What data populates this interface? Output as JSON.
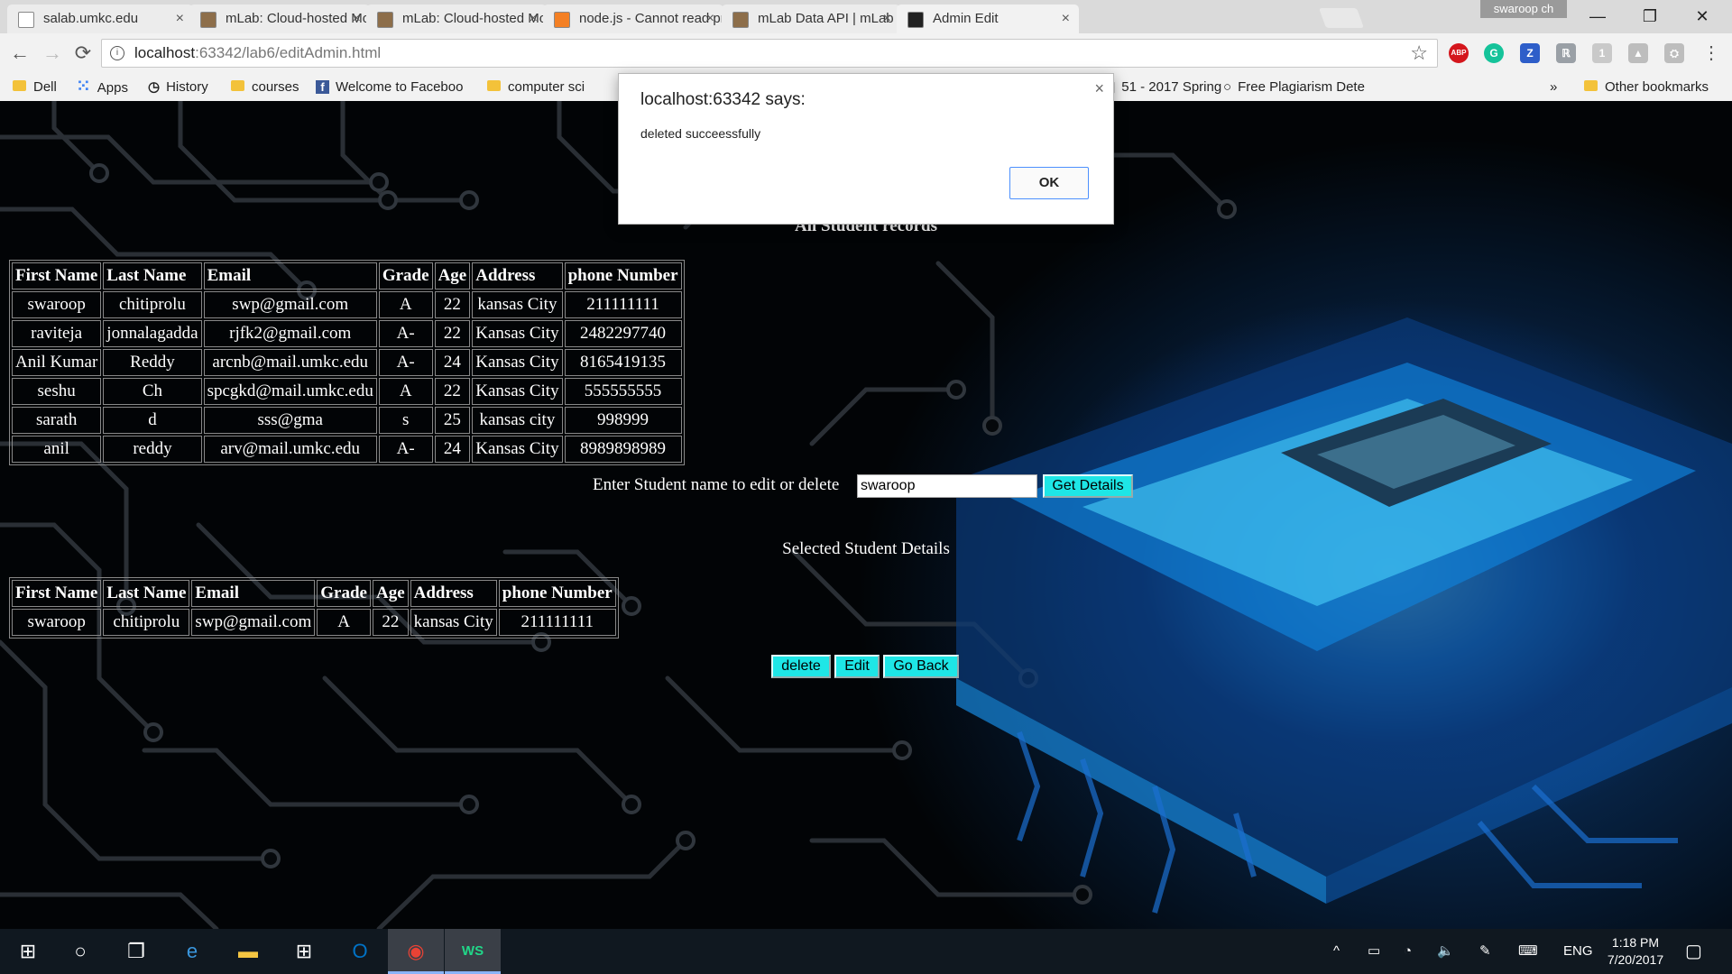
{
  "browser": {
    "tabs": [
      {
        "title": "salab.umkc.edu",
        "favicon_color": "#ffffff"
      },
      {
        "title": "mLab: Cloud-hosted Mo",
        "favicon_color": "#8d6e4a"
      },
      {
        "title": "mLab: Cloud-hosted Mo",
        "favicon_color": "#8d6e4a"
      },
      {
        "title": "node.js - Cannot read pr",
        "favicon_color": "#f48024"
      },
      {
        "title": "mLab Data API | mLab D",
        "favicon_color": "#8d6e4a"
      },
      {
        "title": "Admin Edit",
        "favicon_color": "#222222",
        "active": true
      }
    ],
    "tab_close_symbol": "×",
    "profile_name": "swaroop ch",
    "window_controls": {
      "minimize": "—",
      "restore": "❐",
      "close": "✕"
    },
    "nav": {
      "back": "←",
      "forward": "→",
      "reload": "⟳"
    },
    "address": {
      "host": "localhost",
      "path": ":63342/lab6/editAdmin.html"
    },
    "bookmarks": [
      {
        "label": "Dell",
        "icon": "folder-icon"
      },
      {
        "label": "Apps",
        "icon": "apps-grid-icon"
      },
      {
        "label": "History",
        "icon": "history-icon"
      },
      {
        "label": "courses",
        "icon": "folder-icon"
      },
      {
        "label": "Welcome to Faceboo",
        "icon": "facebook-icon"
      },
      {
        "label": "computer sci",
        "icon": "folder-icon"
      },
      {
        "label": "51 - 2017 Spring",
        "icon": "page-icon"
      },
      {
        "label": "Free Plagiarism Dete",
        "icon": "search-icon"
      }
    ],
    "bookmarks_overflow": "»",
    "other_bookmarks": "Other bookmarks",
    "extensions": [
      {
        "name": "abp",
        "label": "ABP",
        "color": "#d4161c"
      },
      {
        "name": "grammarly",
        "label": "G",
        "color": "#15c39a"
      },
      {
        "name": "z-extension",
        "label": "Z",
        "color": "#2e5ec9"
      },
      {
        "name": "ext-4",
        "label": "ℝ",
        "color": "#9aa0a6"
      },
      {
        "name": "shield-ext",
        "label": "1",
        "color": "#c9c9c9"
      },
      {
        "name": "drive-ext",
        "label": "▲",
        "color": "#bdbdbd"
      },
      {
        "name": "pdf-ext",
        "label": "⛭",
        "color": "#bdbdbd"
      }
    ],
    "menu_symbol": "⋮"
  },
  "dialog": {
    "title": "localhost:63342 says:",
    "message": "deleted succeessfully",
    "ok": "OK",
    "close": "×"
  },
  "page": {
    "heading": "All Student records",
    "columns": [
      "First Name",
      "Last Name",
      "Email",
      "Grade",
      "Age",
      "Address",
      "phone Number"
    ],
    "students": [
      [
        "swaroop",
        "chitiprolu",
        "swp@gmail.com",
        "A",
        "22",
        "kansas City",
        "211111111"
      ],
      [
        "raviteja",
        "jonnalagadda",
        "rjfk2@gmail.com",
        "A-",
        "22",
        "Kansas City",
        "2482297740"
      ],
      [
        "Anil Kumar",
        "Reddy",
        "arcnb@mail.umkc.edu",
        "A-",
        "24",
        "Kansas City",
        "8165419135"
      ],
      [
        "seshu",
        "Ch",
        "spcgkd@mail.umkc.edu",
        "A",
        "22",
        "Kansas City",
        "555555555"
      ],
      [
        "sarath",
        "d",
        "sss@gma",
        "s",
        "25",
        "kansas city",
        "998999"
      ],
      [
        "anil",
        "reddy",
        "arv@mail.umkc.edu",
        "A-",
        "24",
        "Kansas City",
        "8989898989"
      ]
    ],
    "search_label": "Enter Student name to edit or delete",
    "search_value": "swaroop",
    "get_details": "Get Details",
    "selected_heading": "Selected Student Details",
    "selected": [
      [
        "swaroop",
        "chitiprolu",
        "swp@gmail.com",
        "A",
        "22",
        "kansas City",
        "211111111"
      ]
    ],
    "buttons": {
      "delete": "delete",
      "edit": "Edit",
      "go_back": "Go Back"
    },
    "button_color": "#1ee6e6"
  },
  "taskbar": {
    "apps": [
      {
        "name": "start",
        "glyph": "⊞"
      },
      {
        "name": "search",
        "glyph": "○"
      },
      {
        "name": "task-view",
        "glyph": "❐"
      },
      {
        "name": "edge",
        "glyph": "e"
      },
      {
        "name": "file-explorer",
        "glyph": "▬"
      },
      {
        "name": "store",
        "glyph": "⊞"
      },
      {
        "name": "outlook",
        "glyph": "O"
      },
      {
        "name": "chrome",
        "glyph": "◉",
        "active": true
      },
      {
        "name": "webstorm",
        "glyph": "WS",
        "active": true
      }
    ],
    "tray_icons": [
      "^",
      "▭",
      "◔",
      "🔈",
      "✎",
      "⌨"
    ],
    "language": "ENG",
    "time": "1:18 PM",
    "date": "7/20/2017",
    "notification_icon": "▢"
  }
}
